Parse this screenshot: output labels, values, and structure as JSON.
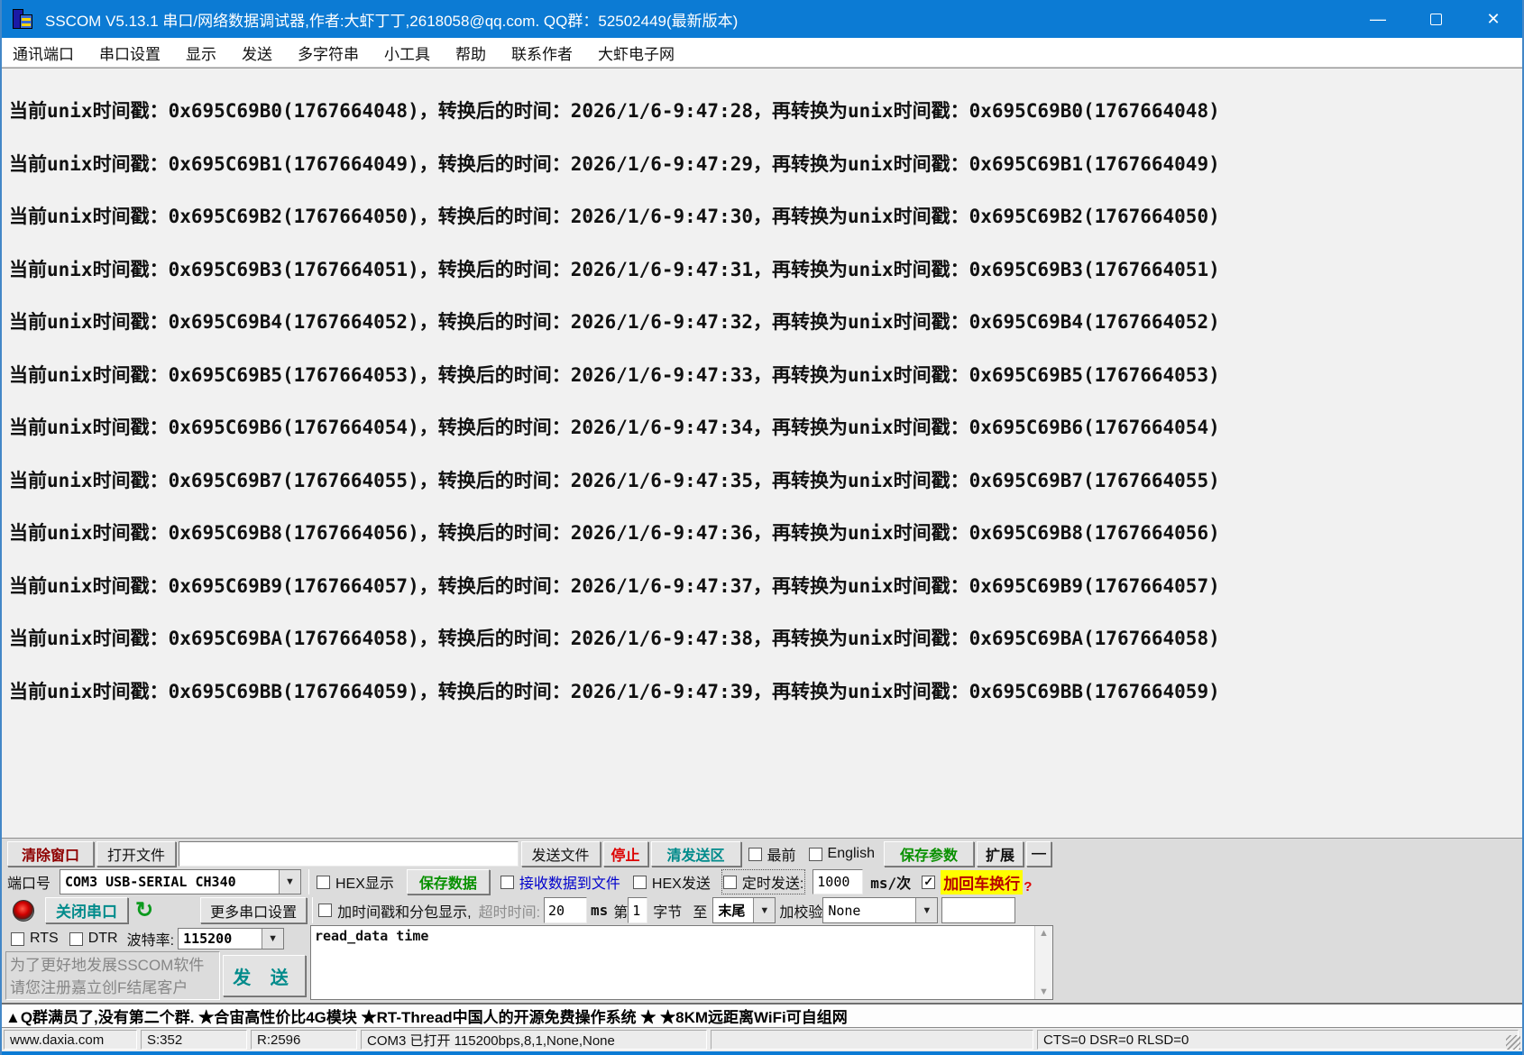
{
  "colors": {
    "titlebar_blue": "#0c7bd4",
    "teal_accent": "#008b8b",
    "green_accent": "#089000",
    "red_accent": "#dd0000",
    "dark_red_accent": "#8f0000",
    "link_blue": "#0000cc",
    "highlight_yellow": "#ffff00",
    "terminal_bg": "#f1f1f1",
    "panel_bg": "#dcdcdc"
  },
  "window": {
    "title": "SSCOM V5.13.1 串口/网络数据调试器,作者:大虾丁丁,2618058@qq.com. QQ群：52502449(最新版本)",
    "minimize_glyph": "—",
    "close_glyph": "✕"
  },
  "menu": {
    "items": [
      "通讯端口",
      "串口设置",
      "显示",
      "发送",
      "多字符串",
      "小工具",
      "帮助",
      "联系作者",
      "大虾电子网"
    ]
  },
  "terminal": {
    "lines": [
      "当前unix时间戳：0x695C69B0(1767664048)，转换后的时间：2026/1/6-9:47:28，再转换为unix时间戳：0x695C69B0(1767664048)",
      "当前unix时间戳：0x695C69B1(1767664049)，转换后的时间：2026/1/6-9:47:29，再转换为unix时间戳：0x695C69B1(1767664049)",
      "当前unix时间戳：0x695C69B2(1767664050)，转换后的时间：2026/1/6-9:47:30，再转换为unix时间戳：0x695C69B2(1767664050)",
      "当前unix时间戳：0x695C69B3(1767664051)，转换后的时间：2026/1/6-9:47:31，再转换为unix时间戳：0x695C69B3(1767664051)",
      "当前unix时间戳：0x695C69B4(1767664052)，转换后的时间：2026/1/6-9:47:32，再转换为unix时间戳：0x695C69B4(1767664052)",
      "当前unix时间戳：0x695C69B5(1767664053)，转换后的时间：2026/1/6-9:47:33，再转换为unix时间戳：0x695C69B5(1767664053)",
      "当前unix时间戳：0x695C69B6(1767664054)，转换后的时间：2026/1/6-9:47:34，再转换为unix时间戳：0x695C69B6(1767664054)",
      "当前unix时间戳：0x695C69B7(1767664055)，转换后的时间：2026/1/6-9:47:35，再转换为unix时间戳：0x695C69B7(1767664055)",
      "当前unix时间戳：0x695C69B8(1767664056)，转换后的时间：2026/1/6-9:47:36，再转换为unix时间戳：0x695C69B8(1767664056)",
      "当前unix时间戳：0x695C69B9(1767664057)，转换后的时间：2026/1/6-9:47:37，再转换为unix时间戳：0x695C69B9(1767664057)",
      "当前unix时间戳：0x695C69BA(1767664058)，转换后的时间：2026/1/6-9:47:38，再转换为unix时间戳：0x695C69BA(1767664058)",
      "当前unix时间戳：0x695C69BB(1767664059)，转换后的时间：2026/1/6-9:47:39，再转换为unix时间戳：0x695C69BB(1767664059)"
    ]
  },
  "toolbar_row1": {
    "clear_window": "清除窗口",
    "open_file": "打开文件",
    "file_path_value": "",
    "send_file": "发送文件",
    "stop": "停止",
    "clear_send_area": "清发送区",
    "topmost": "最前",
    "english": "English",
    "save_params": "保存参数",
    "extend": "扩展",
    "collapse": "—"
  },
  "toolbar_row2": {
    "port_label": "端口号",
    "port_value": "COM3 USB-SERIAL CH340",
    "hex_display": "HEX显示",
    "save_data": "保存数据",
    "recv_to_file": "接收数据到文件",
    "hex_send": "HEX发送",
    "timed_send": "定时发送:",
    "interval_value": "1000",
    "interval_unit": "ms/次",
    "append_crlf": "加回车换行",
    "help_mark": "?"
  },
  "toolbar_row3": {
    "close_port": "关闭串口",
    "refresh_glyph": "↻",
    "more_port_settings": "更多串口设置",
    "timestamp_split": "加时间戳和分包显示,",
    "timeout_label": "超时时间:",
    "timeout_value": "20",
    "timeout_unit": "ms",
    "byte_prefix": "第",
    "byte_value": "1",
    "byte_label": "字节",
    "to_label": "至",
    "range_end_value": "末尾",
    "checksum_label": "加校验",
    "checksum_value": "None"
  },
  "toolbar_row4": {
    "rts": "RTS",
    "dtr": "DTR",
    "baud_label": "波特率:",
    "baud_value": "115200"
  },
  "promo": {
    "line1": "为了更好地发展SSCOM软件",
    "line2": "请您注册嘉立创F结尾客户"
  },
  "send": {
    "button_label": "发 送",
    "input_value": "read_data time"
  },
  "notice": {
    "text": "▲Q群满员了,没有第二个群. ★合宙高性价比4G模块 ★RT-Thread中国人的开源免费操作系统 ★ ★8KM远距离WiFi可自组网"
  },
  "statusbar": {
    "website": "www.daxia.com",
    "sent_count": "S:352",
    "recv_count": "R:2596",
    "port_status": "COM3 已打开  115200bps,8,1,None,None",
    "signals": "CTS=0 DSR=0 RLSD=0"
  }
}
